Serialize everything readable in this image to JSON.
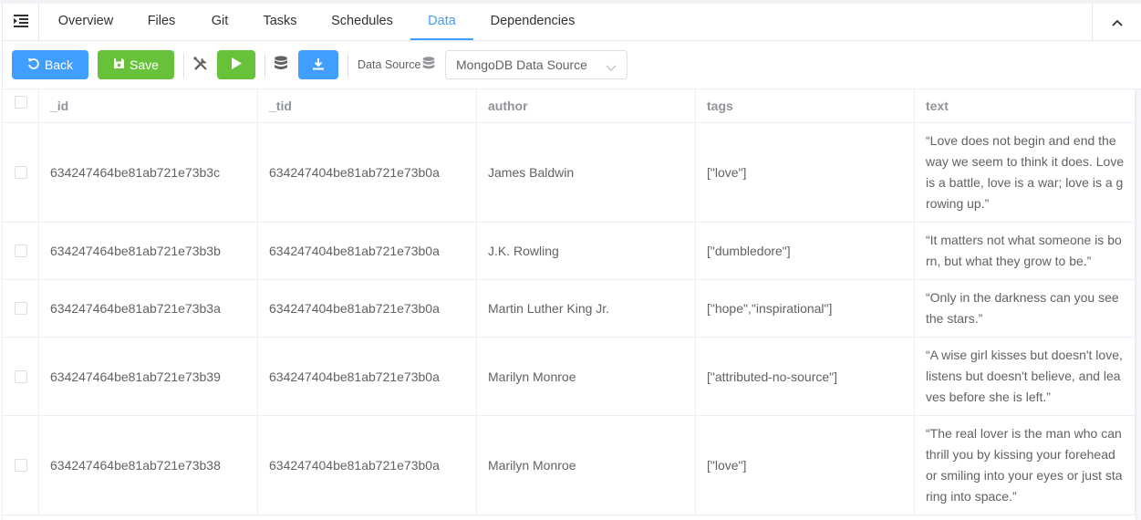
{
  "tabs": [
    {
      "label": "Overview",
      "active": false
    },
    {
      "label": "Files",
      "active": false
    },
    {
      "label": "Git",
      "active": false
    },
    {
      "label": "Tasks",
      "active": false
    },
    {
      "label": "Schedules",
      "active": false
    },
    {
      "label": "Data",
      "active": true
    },
    {
      "label": "Dependencies",
      "active": false
    }
  ],
  "toolbar": {
    "back_label": "Back",
    "save_label": "Save",
    "data_source_label": "Data Source",
    "data_source_value": "MongoDB Data Source"
  },
  "colors": {
    "primary": "#409eff",
    "success": "#67c23a"
  },
  "table": {
    "columns": [
      "_id",
      "_tid",
      "author",
      "tags",
      "text"
    ],
    "rows": [
      {
        "_id": "634247464be81ab721e73b3c",
        "_tid": "634247404be81ab721e73b0a",
        "author": "James Baldwin",
        "tags": "[\"love\"]",
        "text": "“Love does not begin and end the way we seem to think it does. Love is a battle, love is a war; love is a growing up.”"
      },
      {
        "_id": "634247464be81ab721e73b3b",
        "_tid": "634247404be81ab721e73b0a",
        "author": "J.K. Rowling",
        "tags": "[\"dumbledore\"]",
        "text": "“It matters not what someone is born, but what they grow to be.”"
      },
      {
        "_id": "634247464be81ab721e73b3a",
        "_tid": "634247404be81ab721e73b0a",
        "author": "Martin Luther King Jr.",
        "tags": "[\"hope\",\"inspirational\"]",
        "text": "“Only in the darkness can you see the stars.”"
      },
      {
        "_id": "634247464be81ab721e73b39",
        "_tid": "634247404be81ab721e73b0a",
        "author": "Marilyn Monroe",
        "tags": "[\"attributed-no-source\"]",
        "text": "“A wise girl kisses but doesn't love, listens but doesn't believe, and leaves before she is left.”"
      },
      {
        "_id": "634247464be81ab721e73b38",
        "_tid": "634247404be81ab721e73b0a",
        "author": "Marilyn Monroe",
        "tags": "[\"love\"]",
        "text": "“The real lover is the man who can thrill you by kissing your forehead or smiling into your eyes or just staring into space.”"
      }
    ]
  }
}
